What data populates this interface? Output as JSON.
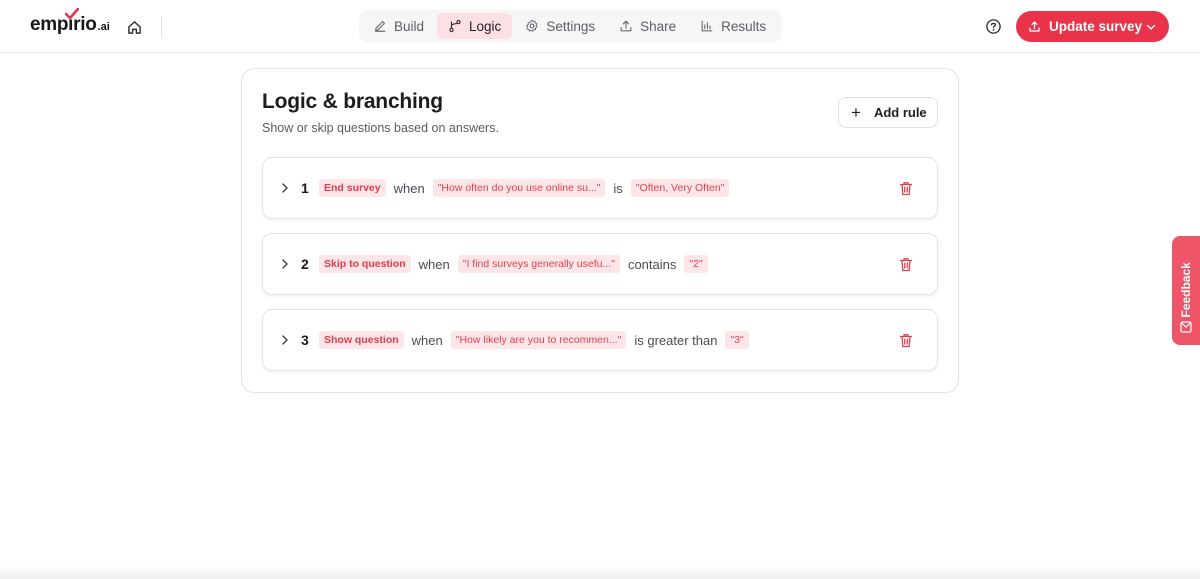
{
  "brand": {
    "name": "empirio",
    "tld": ".ai",
    "accent": "#e8334a"
  },
  "nav": {
    "tabs": [
      {
        "label": "Build",
        "icon": "pencil-icon"
      },
      {
        "label": "Logic",
        "icon": "branch-icon",
        "active": true
      },
      {
        "label": "Settings",
        "icon": "gear-icon"
      },
      {
        "label": "Share",
        "icon": "upload-icon"
      },
      {
        "label": "Results",
        "icon": "bar-chart-icon"
      }
    ]
  },
  "header": {
    "update_label": "Update survey"
  },
  "page": {
    "title": "Logic & branching",
    "subtitle": "Show or skip questions based on answers.",
    "add_rule_label": "Add rule"
  },
  "rules": [
    {
      "num": "1",
      "action": "End survey",
      "when": "when",
      "question": "\"How often do you use online su...\"",
      "operator": "is",
      "value": "\"Often, Very Often\""
    },
    {
      "num": "2",
      "action": "Skip to question",
      "when": "when",
      "question": "\"I find surveys generally usefu...\"",
      "operator": "contains",
      "value": "\"2\""
    },
    {
      "num": "3",
      "action": "Show question",
      "when": "when",
      "question": "\"How likely are you to recommen...\"",
      "operator": "is greater than",
      "value": "\"3\""
    }
  ],
  "feedback": {
    "label": "Feedback"
  }
}
